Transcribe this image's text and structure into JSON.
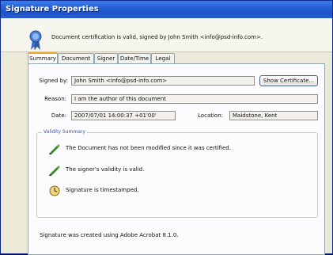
{
  "window": {
    "title": "Signature Properties"
  },
  "info": {
    "text": "Document certification is valid, signed by John Smith <info@psd-info.com>."
  },
  "tabs": [
    {
      "label": "Summary"
    },
    {
      "label": "Document"
    },
    {
      "label": "Signer"
    },
    {
      "label": "Date/Time"
    },
    {
      "label": "Legal"
    }
  ],
  "summary": {
    "signed_by_label": "Signed by:",
    "signed_by_value": "John Smith <info@psd-info.com>",
    "show_certificate_label": "Show Certificate...",
    "reason_label": "Reason:",
    "reason_value": "I am the author of this document",
    "date_label": "Date:",
    "date_value": "2007/07/01 14:00:37 +01'00'",
    "location_label": "Location:",
    "location_value": "Maidstone, Kent"
  },
  "validity": {
    "legend": "Validity Summary",
    "items": [
      {
        "icon": "pen-check-icon",
        "text": "The Document has not been modified since it was certified."
      },
      {
        "icon": "pen-check-icon",
        "text": "The signer's validity is valid."
      },
      {
        "icon": "clock-icon",
        "text": "Signature is timestamped."
      }
    ]
  },
  "footer": {
    "text": "Signature was created using Adobe Acrobat 8.1.0."
  },
  "colors": {
    "title_bar": "#2763d6",
    "tab_highlight": "#f5a623",
    "legend_text": "#3a56a8"
  }
}
